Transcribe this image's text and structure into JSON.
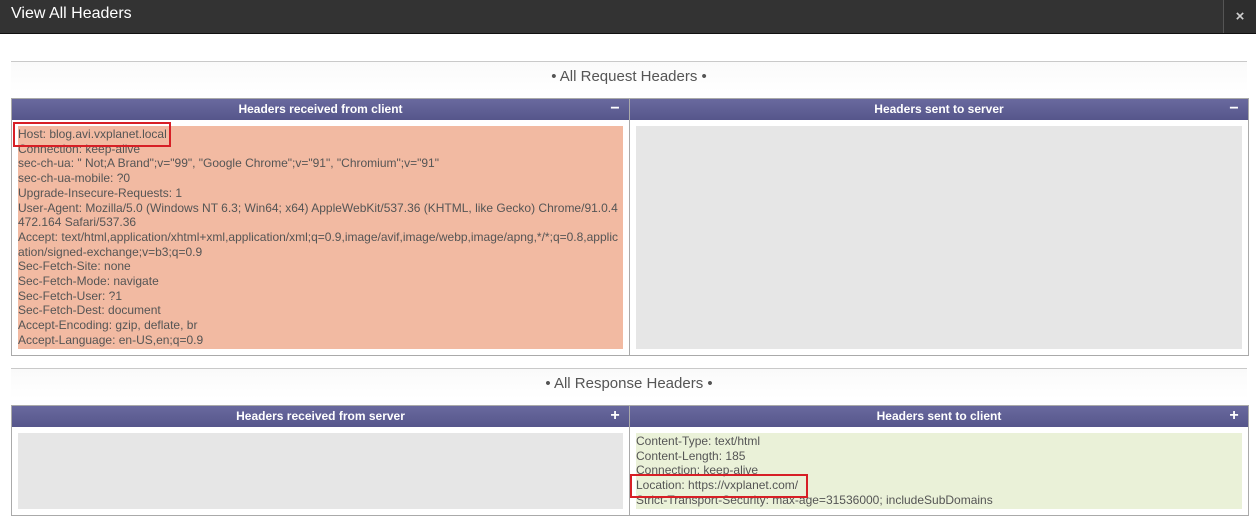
{
  "dialog": {
    "title": "View All Headers",
    "close_label": "×"
  },
  "request_section": {
    "title": "• All Request Headers •",
    "left": {
      "header": "Headers received from client",
      "toggle": "−",
      "lines": [
        "Host: blog.avi.vxplanet.local",
        "Connection: keep-alive",
        "sec-ch-ua: \" Not;A Brand\";v=\"99\", \"Google Chrome\";v=\"91\", \"Chromium\";v=\"91\"",
        "sec-ch-ua-mobile: ?0",
        "Upgrade-Insecure-Requests: 1",
        "User-Agent: Mozilla/5.0 (Windows NT 6.3; Win64; x64) AppleWebKit/537.36 (KHTML, like Gecko) Chrome/91.0.4472.164 Safari/537.36",
        "Accept: text/html,application/xhtml+xml,application/xml;q=0.9,image/avif,image/webp,image/apng,*/*;q=0.8,application/signed-exchange;v=b3;q=0.9",
        "Sec-Fetch-Site: none",
        "Sec-Fetch-Mode: navigate",
        "Sec-Fetch-User: ?1",
        "Sec-Fetch-Dest: document",
        "Accept-Encoding: gzip, deflate, br",
        "Accept-Language: en-US,en;q=0.9"
      ]
    },
    "right": {
      "header": "Headers sent to server",
      "toggle": "−"
    }
  },
  "response_section": {
    "title": "• All Response Headers •",
    "left": {
      "header": "Headers received from server",
      "toggle": "+"
    },
    "right": {
      "header": "Headers sent to client",
      "toggle": "+",
      "lines": [
        "Content-Type: text/html",
        "Content-Length: 185",
        "Connection: keep-alive",
        "Location: https://vxplanet.com/",
        "Strict-Transport-Security: max-age=31536000; includeSubDomains"
      ]
    }
  }
}
